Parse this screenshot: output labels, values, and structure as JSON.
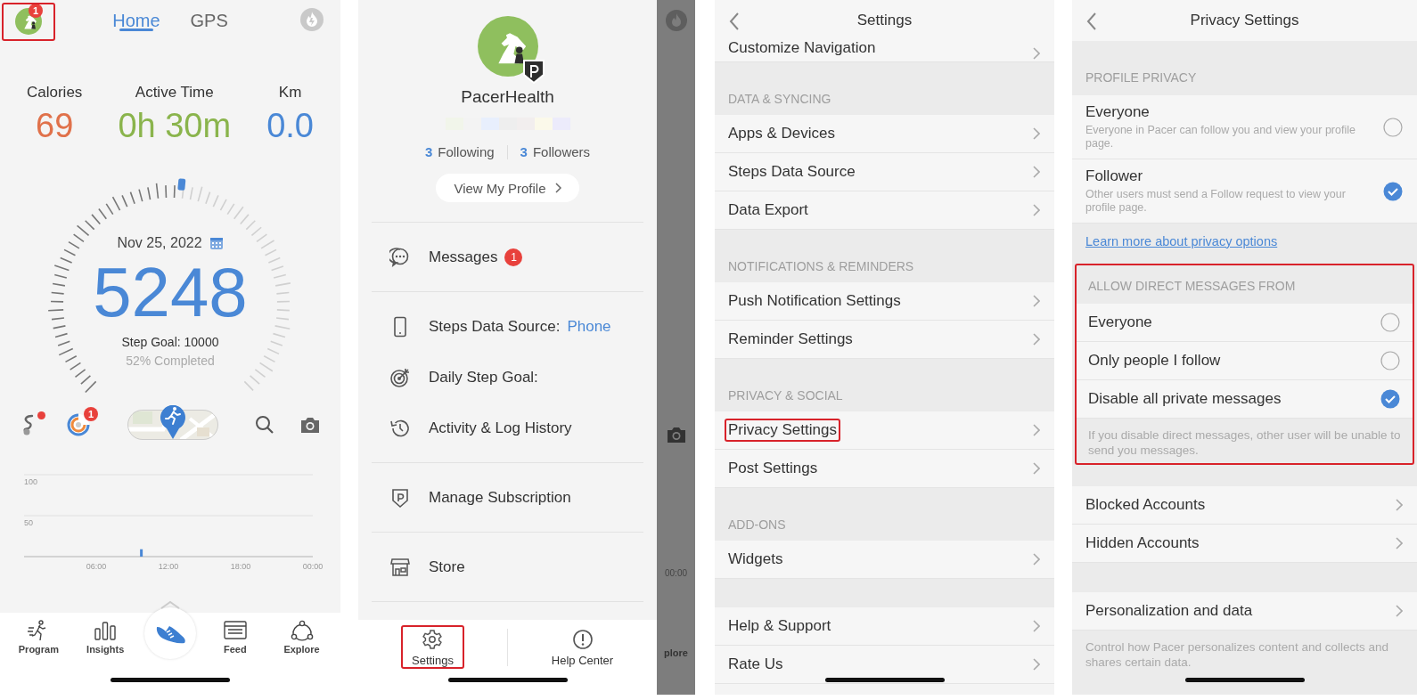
{
  "home": {
    "avatar_badge": "1",
    "highlighted": true,
    "tabs": [
      {
        "label": "Home",
        "selected": true
      },
      {
        "label": "GPS",
        "selected": false
      }
    ],
    "stats": [
      {
        "label": "Calories",
        "value": "69",
        "color": "#e0714a"
      },
      {
        "label": "Active Time",
        "value": "0h 30m",
        "color": "#8ab44c"
      },
      {
        "label": "Km",
        "value": "0.0",
        "color": "#4a88d6"
      }
    ],
    "gauge": {
      "date": "Nov 25, 2022",
      "steps": "5248",
      "goal": "Step Goal: 10000",
      "completed": "52% Completed",
      "level": 0.52
    },
    "tools": [
      {
        "kind": "route",
        "dot": true
      },
      {
        "kind": "challenge",
        "badge": "1"
      },
      {
        "kind": "map"
      },
      {
        "kind": "search"
      },
      {
        "kind": "camera"
      }
    ],
    "chart_data": {
      "type": "bar",
      "x": [
        9.75
      ],
      "values": [
        9
      ],
      "xlim": [
        0,
        24
      ],
      "ylim": [
        0,
        100
      ],
      "yticks": [
        50,
        100
      ],
      "xticks": [
        {
          "value": 6,
          "label": "06:00"
        },
        {
          "value": 12,
          "label": "12:00"
        },
        {
          "value": 18,
          "label": "18:00"
        },
        {
          "value": 24,
          "label": "00:00"
        }
      ]
    },
    "nav": [
      {
        "kind": "program",
        "label": "Program"
      },
      {
        "kind": "insights",
        "label": "Insights"
      },
      {
        "kind": "start"
      },
      {
        "kind": "feed",
        "label": "Feed"
      },
      {
        "kind": "explore",
        "label": "Explore"
      }
    ]
  },
  "drawer": {
    "name": "PacerHealth",
    "following_count": "3",
    "following_label": "Following",
    "followers_count": "3",
    "followers_label": "Followers",
    "profile_button": "View My Profile",
    "groups": [
      [
        {
          "kind": "messages",
          "label": "Messages",
          "badge": "1"
        }
      ],
      [
        {
          "kind": "device",
          "label": "Steps Data Source:",
          "value": "Phone"
        },
        {
          "kind": "goal",
          "label": "Daily Step Goal:"
        },
        {
          "kind": "history",
          "label": "Activity & Log History"
        }
      ],
      [
        {
          "kind": "subscription",
          "label": "Manage Subscription"
        }
      ],
      [
        {
          "kind": "store",
          "label": "Store"
        }
      ]
    ],
    "footer": [
      {
        "kind": "settings",
        "label": "Settings",
        "highlighted": true
      },
      {
        "kind": "help",
        "label": "Help Center",
        "highlighted": false
      }
    ],
    "behind": {
      "chart_tick": "00:00",
      "nav_label": "plore"
    }
  },
  "settings": {
    "title": "Settings",
    "sections": [
      {
        "rows": [
          {
            "label": "Customize Navigation",
            "highlighted": false
          }
        ]
      },
      {
        "header": "DATA & SYNCING",
        "rows": [
          {
            "label": "Apps & Devices",
            "highlighted": false
          },
          {
            "label": "Steps Data Source",
            "highlighted": false
          },
          {
            "label": "Data Export",
            "highlighted": false
          }
        ]
      },
      {
        "header": "NOTIFICATIONS & REMINDERS",
        "rows": [
          {
            "label": "Push Notification Settings",
            "highlighted": false
          },
          {
            "label": "Reminder Settings",
            "highlighted": false
          }
        ]
      },
      {
        "header": "PRIVACY & SOCIAL",
        "rows": [
          {
            "label": "Privacy Settings",
            "highlighted": true
          },
          {
            "label": "Post Settings",
            "highlighted": false
          }
        ]
      },
      {
        "header": "ADD-ONS",
        "rows": [
          {
            "label": "Widgets",
            "highlighted": false
          }
        ]
      },
      {
        "rows": [
          {
            "label": "Help & Support",
            "highlighted": false
          },
          {
            "label": "Rate Us",
            "highlighted": false
          }
        ]
      }
    ]
  },
  "privacy": {
    "title": "Privacy Settings",
    "blocks": [
      {
        "kind": "section",
        "header": "PROFILE PRIVACY",
        "highlighted": false,
        "items": [
          {
            "kind": "radio",
            "label": "Everyone",
            "description": "Everyone in Pacer can follow you and view your profile page.",
            "selected": false
          },
          {
            "kind": "radio",
            "label": "Follower",
            "description": "Other users must send a Follow request to view your profile page.",
            "selected": true
          }
        ]
      },
      {
        "kind": "link",
        "text": "Learn more about privacy options"
      },
      {
        "kind": "section",
        "header": "ALLOW DIRECT MESSAGES FROM",
        "highlighted": true,
        "items": [
          {
            "kind": "radio",
            "label": "Everyone",
            "selected": false
          },
          {
            "kind": "radio",
            "label": "Only people I follow",
            "selected": false
          },
          {
            "kind": "radio",
            "label": "Disable all private messages",
            "selected": true
          }
        ],
        "note": "If you disable direct messages, other user will be unable to send you messages."
      },
      {
        "kind": "section",
        "highlighted": false,
        "items": [
          {
            "kind": "nav",
            "label": "Blocked Accounts"
          },
          {
            "kind": "nav",
            "label": "Hidden Accounts"
          }
        ]
      },
      {
        "kind": "section",
        "highlighted": false,
        "items": [
          {
            "kind": "nav",
            "label": "Personalization and data"
          }
        ],
        "note": "Control how Pacer personalizes content and collects and shares certain data."
      }
    ]
  }
}
